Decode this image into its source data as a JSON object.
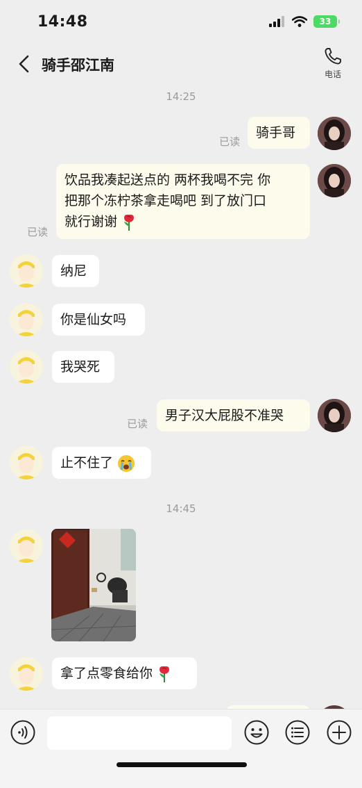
{
  "status_bar": {
    "time": "14:48",
    "battery": "33"
  },
  "header": {
    "title": "骑手邵江南",
    "call_label": "电话"
  },
  "chat": {
    "time_separators": [
      "14:25",
      "14:45"
    ],
    "read_label": "已读",
    "messages": [
      {
        "from": "me",
        "text": "骑手哥",
        "read": "已读"
      },
      {
        "from": "me",
        "lines": [
          "饮品我凑起送点的 两杯我喝不完 你",
          "把那个冻柠茶拿走喝吧 到了放门口",
          "就行谢谢"
        ],
        "emoji": "rose",
        "read": "已读"
      },
      {
        "from": "rider",
        "text": "纳尼"
      },
      {
        "from": "rider",
        "text": "你是仙女吗"
      },
      {
        "from": "rider",
        "text": "我哭死"
      },
      {
        "from": "me",
        "text": "男子汉大屁股不准哭",
        "read": "已读"
      },
      {
        "from": "rider",
        "text": "止不住了",
        "emoji": "loudly-crying-face"
      },
      {
        "from": "rider",
        "type": "image"
      },
      {
        "from": "rider",
        "text": "拿了点零食给你",
        "emoji": "rose"
      }
    ]
  },
  "input_bar": {
    "placeholder": "",
    "icons": [
      "voice-icon",
      "emoji-icon",
      "more-icon",
      "plus-icon"
    ]
  },
  "colors": {
    "background": "#eeeeee",
    "my_bubble": "#fdfbec",
    "their_bubble": "#ffffff",
    "battery": "#4cd964"
  }
}
